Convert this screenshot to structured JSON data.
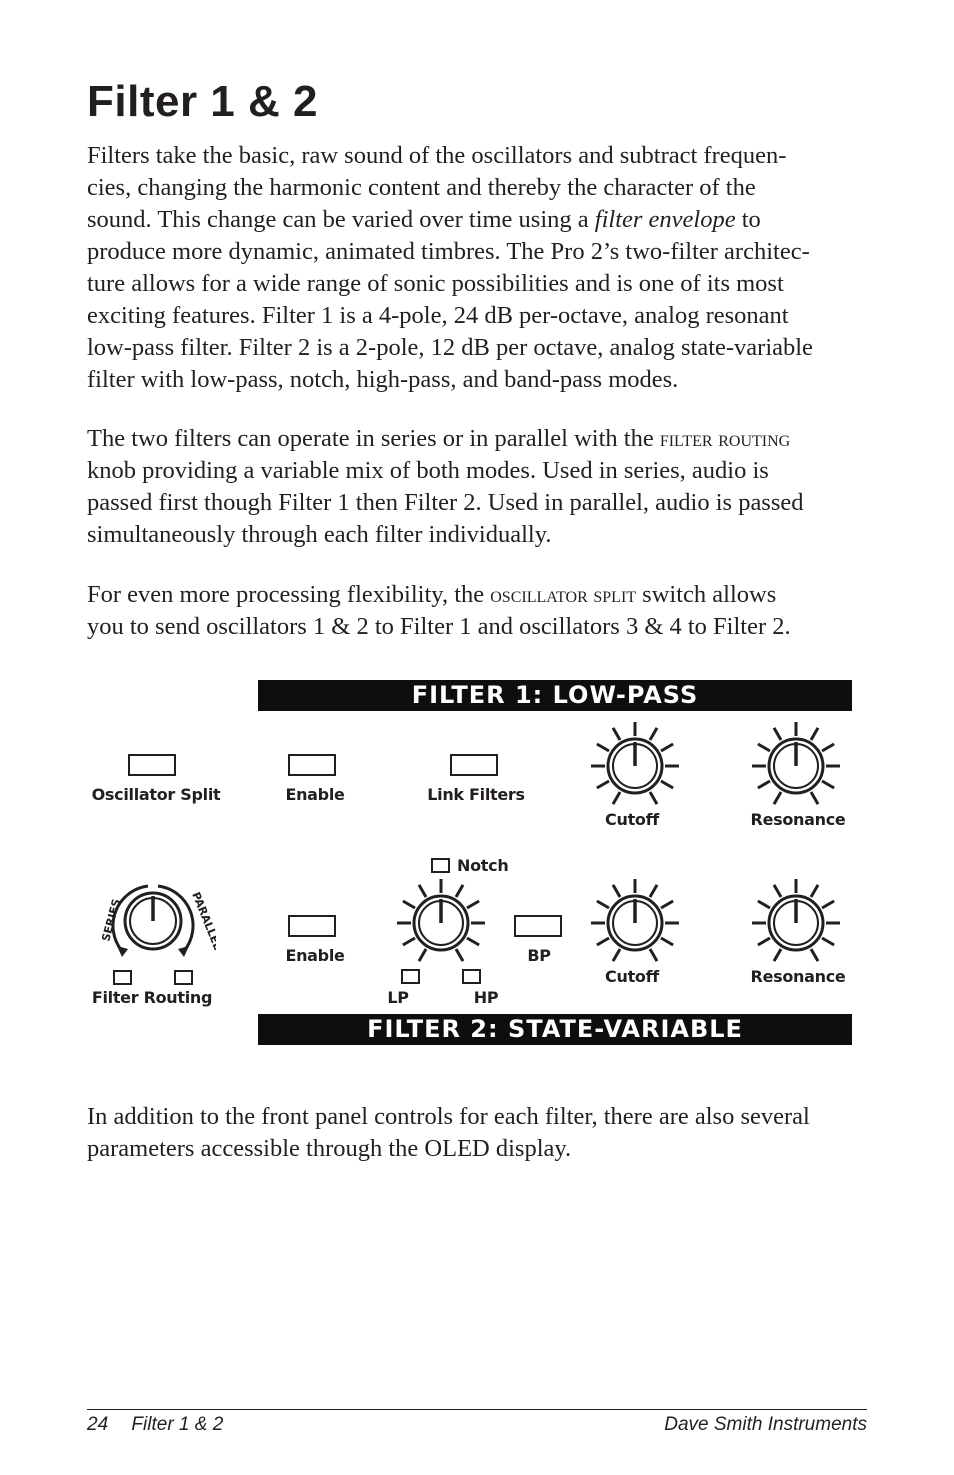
{
  "page": {
    "title": "Filter 1 & 2"
  },
  "paragraphs": {
    "p1": [
      "Filters take the basic, raw sound of the oscillators and subtract frequen-",
      "cies, changing the harmonic content and thereby the character of the",
      {
        "pre": "sound. This change can be varied over time using a ",
        "italic": "filter envelope",
        "post": " to"
      },
      "produce more dynamic, animated timbres. The Pro 2’s two-filter architec-",
      "ture allows for a wide range of sonic possibilities and is one of its most",
      "exciting features. Filter 1 is a 4-pole, 24 dB per-octave, analog resonant",
      "low-pass filter. Filter 2 is a 2-pole, 12 dB per octave, analog state-variable",
      "filter with low-pass, notch, high-pass, and band-pass modes."
    ],
    "p2": [
      {
        "pre": "The two filters can operate in series or in parallel with the ",
        "smallcaps": "Filter Routing",
        "post": ""
      },
      "knob providing a variable mix of both modes. Used in series, audio is",
      "passed first though Filter 1 then Filter 2. Used in parallel, audio is passed",
      "simultaneously through each filter individually."
    ],
    "p3": [
      {
        "pre": "For even more processing flexibility, the ",
        "smallcaps": "Oscillator Split",
        "post": " switch allows"
      },
      "you to send oscillators 1 & 2 to Filter 1 and oscillators 3 & 4 to Filter 2."
    ],
    "p4": [
      "In addition to the front panel controls for each filter, there are also several",
      "parameters accessible through the OLED display."
    ]
  },
  "panel": {
    "filter1_banner": "FILTER 1: LOW-PASS",
    "filter2_banner": "FILTER 2: STATE-VARIABLE",
    "oscillator_split_label": "Oscillator Split",
    "filter1_enable_label": "Enable",
    "link_filters_label": "Link Filters",
    "filter1_cutoff_label": "Cutoff",
    "filter1_resonance_label": "Resonance",
    "notch_label": "Notch",
    "filter_routing_label": "Filter Routing",
    "series_label": "SERIES",
    "parallel_label": "PARALLEL",
    "filter2_enable_label": "Enable",
    "bp_label": "BP",
    "lp_label": "LP",
    "hp_label": "HP",
    "filter2_cutoff_label": "Cutoff",
    "filter2_resonance_label": "Resonance"
  },
  "footer": {
    "page_number": "24",
    "section": "Filter 1 & 2",
    "publisher": "Dave Smith Instruments"
  }
}
